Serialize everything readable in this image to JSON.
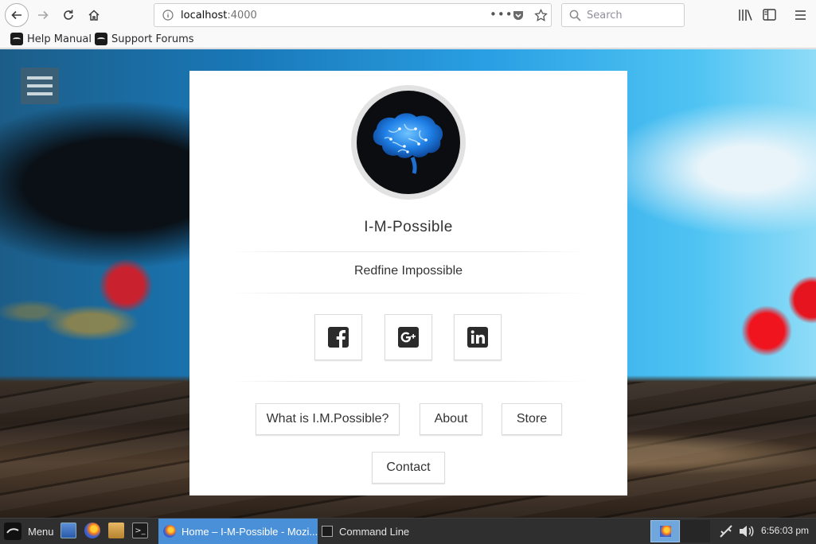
{
  "browser": {
    "url_host": "localhost",
    "url_port": ":4000",
    "search_placeholder": "Search",
    "bookmarks": [
      {
        "label": "Help Manual"
      },
      {
        "label": "Support Forums"
      }
    ]
  },
  "page": {
    "site_title": "I-M-Possible",
    "tagline": "Redfine Impossible",
    "social": [
      {
        "icon": "facebook-icon"
      },
      {
        "icon": "google-plus-icon"
      },
      {
        "icon": "linkedin-icon"
      }
    ],
    "nav_buttons": [
      {
        "label": "What is I.M.Possible?"
      },
      {
        "label": "About"
      },
      {
        "label": "Store"
      },
      {
        "label": "Contact"
      }
    ]
  },
  "taskbar": {
    "menu_label": "Menu",
    "windows": [
      {
        "label": "Home – I-M-Possible - Mozi...",
        "active": true
      },
      {
        "label": "Command Line",
        "active": false
      }
    ],
    "clock": "6:56:03 pm"
  },
  "colors": {
    "taskbar_active": "#4a90d9",
    "brain_glow": "#2a8cff"
  }
}
